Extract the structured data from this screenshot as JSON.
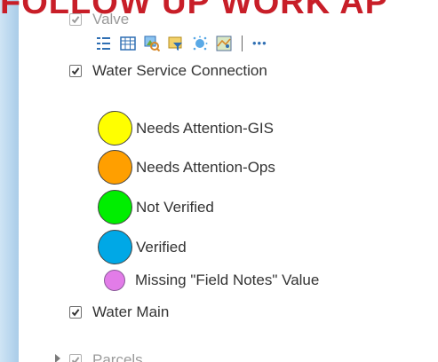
{
  "banner": {
    "text": "FOLLOW UP WORK AP"
  },
  "layers": {
    "valve": {
      "label": "Valve",
      "checked": true
    },
    "service_connection": {
      "label": "Water Service Connection",
      "checked": true
    },
    "water_main": {
      "label": "Water Main",
      "checked": true
    },
    "parcels": {
      "label": "Parcels",
      "checked": true
    }
  },
  "toolbar": {
    "icons": [
      "legend-list-icon",
      "attribute-table-icon",
      "zoom-to-layer-icon",
      "filter-icon",
      "transparency-icon",
      "map-style-icon",
      "more-options-icon"
    ],
    "more_label": "•••"
  },
  "legend": {
    "items": [
      {
        "label": "Needs Attention-GIS",
        "color": "#ffff00"
      },
      {
        "label": "Needs Attention-Ops",
        "color": "#ff9f00"
      },
      {
        "label": "Not Verified",
        "color": "#00ee00"
      },
      {
        "label": "Verified",
        "color": "#00a8e6"
      },
      {
        "label": "Missing \"Field Notes\" Value",
        "color": "#e27ce8"
      }
    ]
  },
  "colors": {
    "banner_red": "#c81e28",
    "left_band": "#b8d6ee",
    "toolbar_blue": "#2f6fb3"
  }
}
